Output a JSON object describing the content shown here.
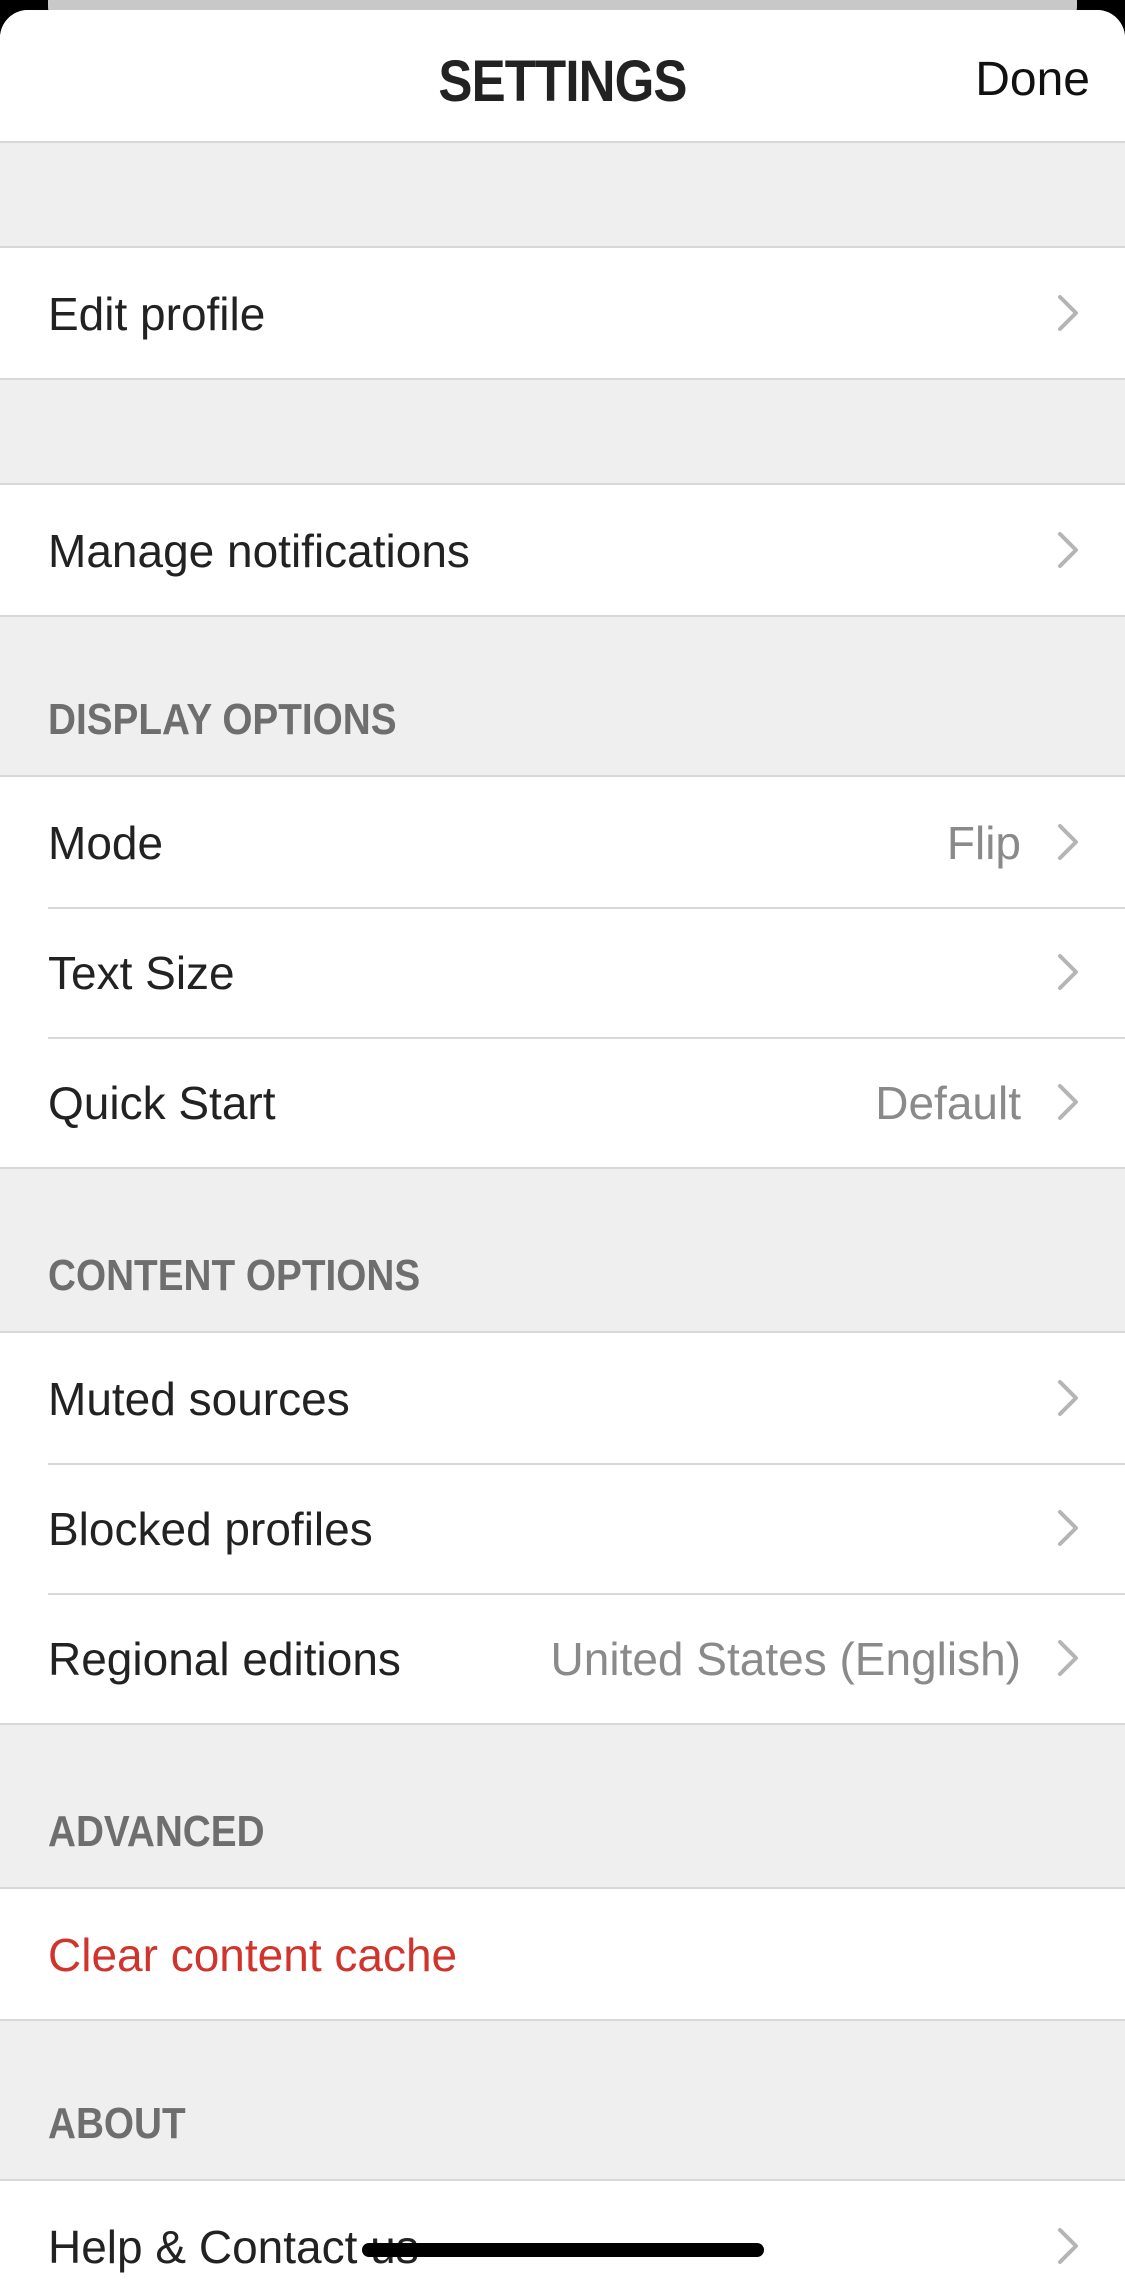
{
  "navbar": {
    "title": "SETTINGS",
    "done_label": "Done"
  },
  "groups": {
    "profile": {
      "edit_profile": "Edit profile"
    },
    "notifications": {
      "manage_notifications": "Manage notifications"
    },
    "display_options": {
      "header": "DISPLAY OPTIONS",
      "mode_label": "Mode",
      "mode_value": "Flip",
      "text_size_label": "Text Size",
      "quick_start_label": "Quick Start",
      "quick_start_value": "Default"
    },
    "content_options": {
      "header": "CONTENT OPTIONS",
      "muted_sources": "Muted sources",
      "blocked_profiles": "Blocked profiles",
      "regional_editions_label": "Regional editions",
      "regional_editions_value": "United States (English)"
    },
    "advanced": {
      "header": "ADVANCED",
      "clear_cache": "Clear content cache"
    },
    "about": {
      "header": "ABOUT",
      "help_contact": "Help & Contact us"
    }
  },
  "icons": {
    "row_disclosure": "chevron-right-icon"
  },
  "colors": {
    "destructive": "#d0342c",
    "secondary_text": "#8a8a8a",
    "section_header": "#6e6e6e",
    "grouped_background": "#efefef"
  }
}
